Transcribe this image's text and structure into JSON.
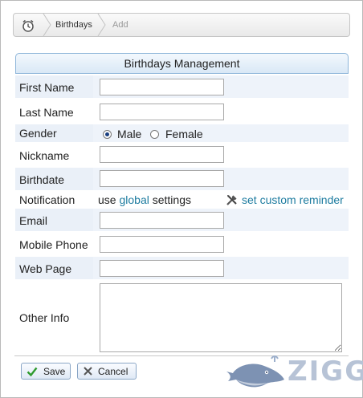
{
  "breadcrumb": {
    "home_icon": "alarm-clock-icon",
    "items": [
      "Birthdays",
      "Add"
    ]
  },
  "form": {
    "title": "Birthdays Management",
    "fields": {
      "first_name": {
        "label": "First Name",
        "value": ""
      },
      "last_name": {
        "label": "Last Name",
        "value": ""
      },
      "gender": {
        "label": "Gender",
        "options": [
          "Male",
          "Female"
        ],
        "selected": "Male"
      },
      "nickname": {
        "label": "Nickname",
        "value": ""
      },
      "birthdate": {
        "label": "Birthdate",
        "value": ""
      },
      "notification": {
        "label": "Notification",
        "prefix": "use",
        "link": "global",
        "suffix": "settings",
        "custom_link": "set custom reminder",
        "custom_icon": "tools-icon"
      },
      "email": {
        "label": "Email",
        "value": ""
      },
      "mobile_phone": {
        "label": "Mobile Phone",
        "value": ""
      },
      "web_page": {
        "label": "Web Page",
        "value": ""
      },
      "other_info": {
        "label": "Other Info",
        "value": ""
      }
    }
  },
  "actions": {
    "save": {
      "label": "Save",
      "icon": "check-icon"
    },
    "cancel": {
      "label": "Cancel",
      "icon": "x-icon"
    }
  },
  "watermark": {
    "text": "ZIGG",
    "icon": "whale-icon"
  },
  "colors": {
    "link": "#1e7ca0",
    "header_border": "#8db5d9",
    "band": "#eef3fa"
  }
}
